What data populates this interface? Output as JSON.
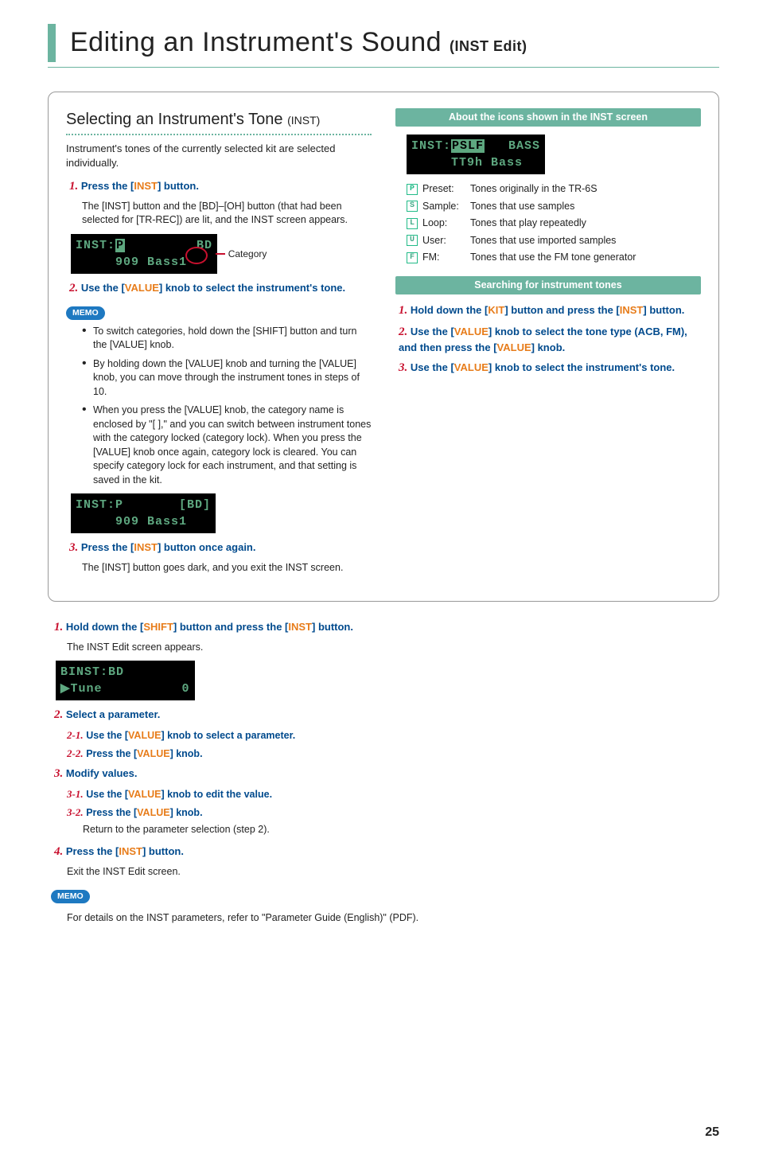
{
  "page": {
    "title_main": "Editing an Instrument's Sound ",
    "title_sub": "(INST Edit)",
    "number": "25"
  },
  "left": {
    "heading_main": "Selecting an Instrument's Tone ",
    "heading_sub": "(INST)",
    "intro": "Instrument's tones of the currently selected kit are selected individually.",
    "step1": {
      "num": "1.",
      "pre": "Press the [",
      "btn": "INST",
      "post": "] button."
    },
    "step1_body": "The [INST] button and the [BD]–[OH] button (that had been selected for [TR-REC]) are lit, and the INST screen appears.",
    "lcd1_a": "INST:",
    "lcd1_icon": "P",
    "lcd1_b": "         BD\n     909 Bass1",
    "lcd1_cat_label": "Category",
    "step2": {
      "num": "2.",
      "pre": "Use the [",
      "btn": "VALUE",
      "post": "] knob to select the instrument's tone."
    },
    "memo": "MEMO",
    "bullets": [
      "To switch categories, hold down the [SHIFT] button and turn the [VALUE] knob.",
      "By holding down the [VALUE] knob and turning the [VALUE] knob, you can move through the instrument tones in steps of 10.",
      "When you press the [VALUE] knob, the category name is enclosed by \"[ ],\" and you can switch between instrument tones with the category locked (category lock). When you press the [VALUE] knob once again, category lock is cleared. You can specify category lock for each instrument, and that setting is saved in the kit."
    ],
    "lcd2": "INST:P       [BD]\n     909 Bass1",
    "step3": {
      "num": "3.",
      "pre": "Press the [",
      "btn": "INST",
      "post": "] button once again."
    },
    "step3_body": "The [INST] button goes dark, and you exit the INST screen."
  },
  "right": {
    "bar1": "About the icons shown in the INST screen",
    "lcd_a": "INST:",
    "lcd_icons": "PSLF",
    "lcd_b": "   BASS\n     TT9h Bass",
    "icons": [
      {
        "chip": "P",
        "name": "Preset:",
        "desc": "Tones originally in the TR-6S"
      },
      {
        "chip": "S",
        "name": "Sample:",
        "desc": "Tones that use samples"
      },
      {
        "chip": "L",
        "name": "Loop:",
        "desc": "Tones that play repeatedly"
      },
      {
        "chip": "U",
        "name": "User:",
        "desc": "Tones that use imported samples"
      },
      {
        "chip": "F",
        "name": "FM:",
        "desc": "Tones that use the FM tone generator"
      }
    ],
    "bar2": "Searching for instrument tones",
    "s1": {
      "num": "1.",
      "pre": "Hold down the [",
      "btn1": "KIT",
      "mid": "] button and press the [",
      "btn2": "INST",
      "post": "] button."
    },
    "s2": {
      "num": "2.",
      "pre": "Use the [",
      "btn1": "VALUE",
      "mid": "] knob to select the tone type (ACB, FM), and then press the [",
      "btn2": "VALUE",
      "post": "] knob."
    },
    "s3": {
      "num": "3.",
      "pre": "Use the [",
      "btn": "VALUE",
      "post": "] knob to select the instrument's tone."
    }
  },
  "bottom": {
    "s1": {
      "num": "1.",
      "pre": "Hold down the [",
      "btn1": "SHIFT",
      "mid": "] button and press the [",
      "btn2": "INST",
      "post": "] button."
    },
    "s1_body": "The INST Edit screen appears.",
    "lcd": "BINST:BD\n▶Tune          0",
    "s2": {
      "num": "2.",
      "text": "Select a parameter."
    },
    "s2_1": {
      "num": "2-1.",
      "pre": "Use the [",
      "btn": "VALUE",
      "post": "] knob to select a parameter."
    },
    "s2_2": {
      "num": "2-2.",
      "pre": "Press the [",
      "btn": "VALUE",
      "post": "] knob."
    },
    "s3": {
      "num": "3.",
      "text": "Modify values."
    },
    "s3_1": {
      "num": "3-1.",
      "pre": "Use the [",
      "btn": "VALUE",
      "post": "] knob to edit the value."
    },
    "s3_2": {
      "num": "3-2.",
      "pre": "Press the [",
      "btn": "VALUE",
      "post": "] knob."
    },
    "s3_2_body": "Return to the parameter selection (step 2).",
    "s4": {
      "num": "4.",
      "pre": "Press the [",
      "btn": "INST",
      "post": "] button."
    },
    "s4_body": "Exit the INST Edit screen.",
    "memo": "MEMO",
    "memo_body": "For details on the INST parameters, refer to \"Parameter Guide (English)\" (PDF)."
  }
}
